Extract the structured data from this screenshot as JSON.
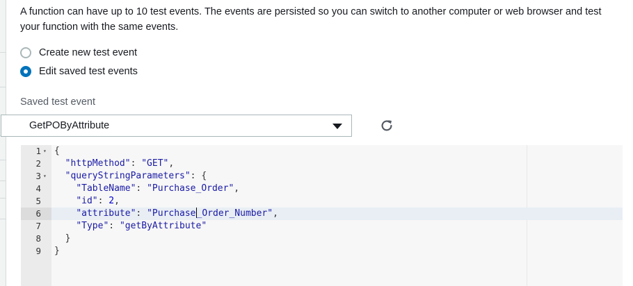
{
  "description": "A function can have up to 10 test events. The events are persisted so you can switch to another computer or web browser and test your function with the same events.",
  "radio_options": [
    {
      "label": "Create new test event",
      "checked": false
    },
    {
      "label": "Edit saved test events",
      "checked": true
    }
  ],
  "saved_event": {
    "label": "Saved test event",
    "selected": "GetPOByAttribute"
  },
  "icons": {
    "dropdown": "caret-down-icon",
    "refresh": "refresh-icon"
  },
  "colors": {
    "accent": "#0073bb",
    "string": "#1a1aa6",
    "number": "#0000cd",
    "active_line": "#e8eef4"
  },
  "editor": {
    "active_line": 6,
    "lines": [
      {
        "num": "1",
        "fold": true,
        "indent": "",
        "key": "",
        "sep": "",
        "value": "{",
        "trail": ""
      },
      {
        "num": "2",
        "fold": false,
        "indent": "  ",
        "key": "\"httpMethod\"",
        "sep": ": ",
        "value": "\"GET\"",
        "trail": ","
      },
      {
        "num": "3",
        "fold": true,
        "indent": "  ",
        "key": "\"queryStringParameters\"",
        "sep": ": ",
        "value": "{",
        "trail": ""
      },
      {
        "num": "4",
        "fold": false,
        "indent": "    ",
        "key": "\"TableName\"",
        "sep": ": ",
        "value": "\"Purchase_Order\"",
        "trail": ","
      },
      {
        "num": "5",
        "fold": false,
        "indent": "    ",
        "key": "\"id\"",
        "sep": ": ",
        "value": "2",
        "trail": ","
      },
      {
        "num": "6",
        "fold": false,
        "indent": "    ",
        "key": "\"attribute\"",
        "sep": ": ",
        "value": "\"Purchase_Order_Number\"",
        "trail": ","
      },
      {
        "num": "7",
        "fold": false,
        "indent": "    ",
        "key": "\"Type\"",
        "sep": ": ",
        "value": "\"getByAttribute\"",
        "trail": ""
      },
      {
        "num": "8",
        "fold": false,
        "indent": "  ",
        "key": "",
        "sep": "",
        "value": "}",
        "trail": ""
      },
      {
        "num": "9",
        "fold": false,
        "indent": "",
        "key": "",
        "sep": "",
        "value": "}",
        "trail": ""
      }
    ]
  }
}
